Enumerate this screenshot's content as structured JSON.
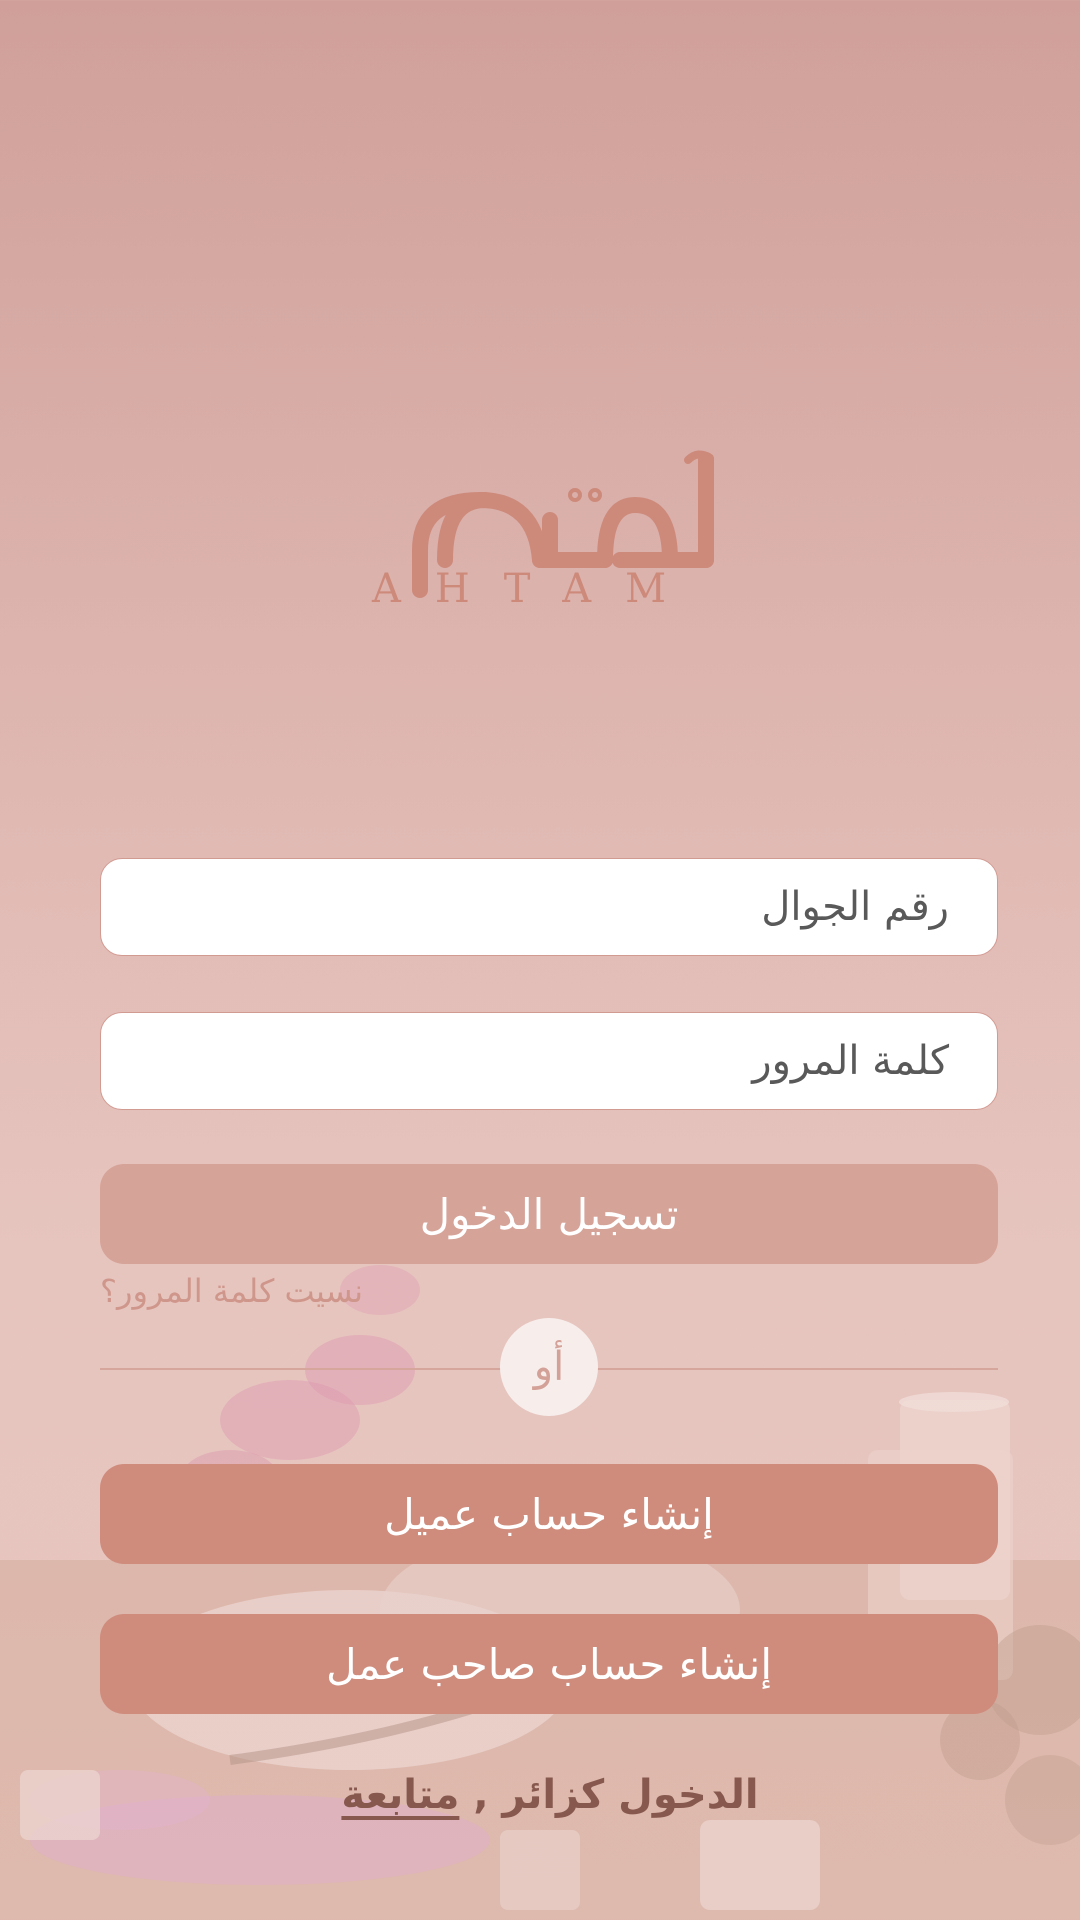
{
  "brand": {
    "arabic_name": "أهتم",
    "latin_name": "AHTAM",
    "color": "#cd8a7b"
  },
  "form": {
    "phone_placeholder": "رقم الجوال",
    "password_placeholder": "كلمة المرور",
    "login_label": "تسجيل الدخول",
    "forgot_label": "نسيت كلمة المرور؟"
  },
  "divider": {
    "or_label": "أو"
  },
  "signup": {
    "client_label": "إنشاء حساب عميل",
    "business_label": "إنشاء حساب صاحب عمل"
  },
  "guest": {
    "prefix": "الدخول كزائر ,",
    "link_label": "متابعة"
  },
  "colors": {
    "login_button": "#d6a398",
    "signup_button": "#cf8c7d",
    "guest_text": "#87584e",
    "forgot_text": "#cf968b"
  }
}
